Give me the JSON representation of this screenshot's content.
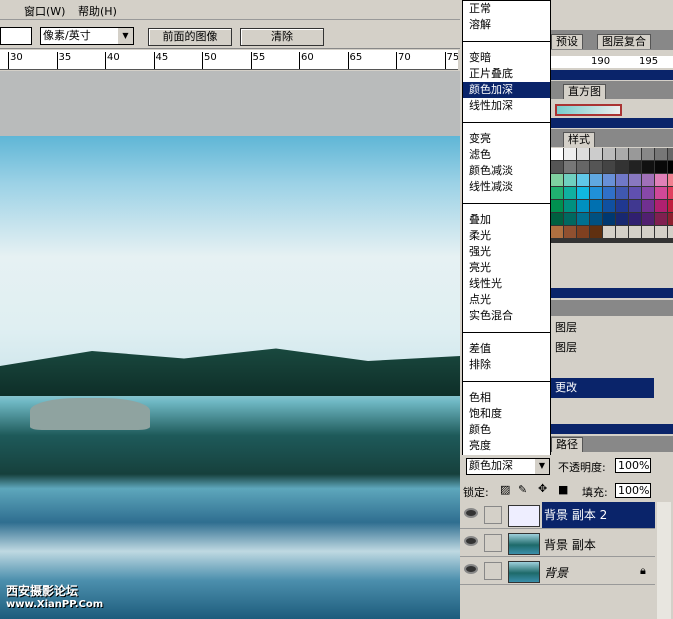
{
  "menubar": {
    "items": [
      "窗口(W)",
      "帮助(H)"
    ]
  },
  "toolbar": {
    "unit_select": "像素/英寸",
    "front_image_btn": "前面的图像",
    "clear_btn": "清除"
  },
  "ruler": {
    "ticks": [
      "30",
      "35",
      "40",
      "45",
      "50",
      "55",
      "60",
      "65",
      "70",
      "75"
    ]
  },
  "blend_menu": {
    "groups": [
      [
        "正常",
        "溶解"
      ],
      [
        "变暗",
        "正片叠底",
        "颜色加深",
        "线性加深"
      ],
      [
        "变亮",
        "滤色",
        "颜色减淡",
        "线性减淡"
      ],
      [
        "叠加",
        "柔光",
        "强光",
        "亮光",
        "线性光",
        "点光",
        "实色混合"
      ],
      [
        "差值",
        "排除"
      ],
      [
        "色相",
        "饱和度",
        "颜色",
        "亮度"
      ]
    ],
    "selected": "颜色加深"
  },
  "panels": {
    "tabs_top": [
      "预设",
      "图层复合"
    ],
    "ruler2": [
      "190",
      "195"
    ],
    "histogram_tab": "直方图",
    "style_tab": "样式",
    "history_items": [
      "图层",
      "图层",
      "更改"
    ],
    "paths_tab": "路径"
  },
  "layers": {
    "blend_mode": "颜色加深",
    "opacity_label": "不透明度:",
    "opacity": "100%",
    "lock_label": "锁定:",
    "fill_label": "填充:",
    "fill": "100%",
    "rows": [
      {
        "name": "背景 副本 2",
        "selected": true
      },
      {
        "name": "背景 副本",
        "selected": false
      },
      {
        "name": "背景",
        "selected": false,
        "locked": true
      }
    ]
  },
  "watermark": {
    "line1": "西安摄影论坛",
    "line2": "www.XianPP.Com"
  },
  "colors": {
    "selection": "#0a246a",
    "panel": "#d4d0c8"
  }
}
